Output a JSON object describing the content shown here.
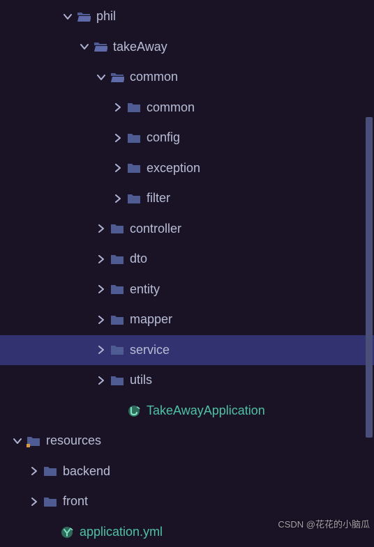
{
  "tree": [
    {
      "indent": 88,
      "chev": "down",
      "icon": "folder-open",
      "label": "phil",
      "cls": "",
      "sel": false
    },
    {
      "indent": 112,
      "chev": "down",
      "icon": "folder-open",
      "label": "takeAway",
      "cls": "",
      "sel": false
    },
    {
      "indent": 136,
      "chev": "down",
      "icon": "folder-open",
      "label": "common",
      "cls": "",
      "sel": false
    },
    {
      "indent": 160,
      "chev": "right",
      "icon": "folder-closed",
      "label": "common",
      "cls": "",
      "sel": false
    },
    {
      "indent": 160,
      "chev": "right",
      "icon": "folder-closed",
      "label": "config",
      "cls": "",
      "sel": false
    },
    {
      "indent": 160,
      "chev": "right",
      "icon": "folder-closed",
      "label": "exception",
      "cls": "",
      "sel": false
    },
    {
      "indent": 160,
      "chev": "right",
      "icon": "folder-closed",
      "label": "filter",
      "cls": "",
      "sel": false
    },
    {
      "indent": 136,
      "chev": "right",
      "icon": "folder-closed",
      "label": "controller",
      "cls": "",
      "sel": false
    },
    {
      "indent": 136,
      "chev": "right",
      "icon": "folder-closed",
      "label": "dto",
      "cls": "",
      "sel": false
    },
    {
      "indent": 136,
      "chev": "right",
      "icon": "folder-closed",
      "label": "entity",
      "cls": "",
      "sel": false
    },
    {
      "indent": 136,
      "chev": "right",
      "icon": "folder-closed",
      "label": "mapper",
      "cls": "",
      "sel": false
    },
    {
      "indent": 136,
      "chev": "right",
      "icon": "folder-closed",
      "label": "service",
      "cls": "",
      "sel": true
    },
    {
      "indent": 136,
      "chev": "right",
      "icon": "folder-closed",
      "label": "utils",
      "cls": "",
      "sel": false
    },
    {
      "indent": 160,
      "chev": "none",
      "icon": "java-class",
      "label": "TakeAwayApplication",
      "cls": "class",
      "sel": false
    },
    {
      "indent": 16,
      "chev": "down",
      "icon": "folder-res",
      "label": "resources",
      "cls": "",
      "sel": false
    },
    {
      "indent": 40,
      "chev": "right",
      "icon": "folder-closed",
      "label": "backend",
      "cls": "",
      "sel": false
    },
    {
      "indent": 40,
      "chev": "right",
      "icon": "folder-closed",
      "label": "front",
      "cls": "",
      "sel": false
    },
    {
      "indent": 64,
      "chev": "none",
      "icon": "yml-file",
      "label": "application.yml",
      "cls": "yml",
      "sel": false
    }
  ],
  "watermark": "CSDN @花花的小脑瓜",
  "colors": {
    "folder": "#4f5b93",
    "chev": "#b0b4d4"
  }
}
